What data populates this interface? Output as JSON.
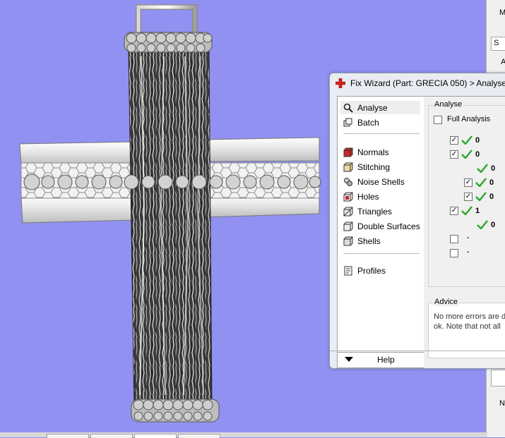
{
  "dialog": {
    "title": "Fix Wizard (Part: GRECIA 050) > Analyse"
  },
  "nav": {
    "items": [
      {
        "label": "Analyse",
        "icon": "magnifier-icon"
      },
      {
        "label": "Batch",
        "icon": "batch-icon"
      },
      {
        "label": "Normals",
        "icon": "normals-cube-icon"
      },
      {
        "label": "Stitching",
        "icon": "stitching-cube-icon"
      },
      {
        "label": "Noise Shells",
        "icon": "noise-shells-icon"
      },
      {
        "label": "Holes",
        "icon": "holes-cube-icon"
      },
      {
        "label": "Triangles",
        "icon": "triangles-cube-icon"
      },
      {
        "label": "Double Surfaces",
        "icon": "double-surfaces-cube-icon"
      },
      {
        "label": "Shells",
        "icon": "shells-cube-icon"
      },
      {
        "label": "Profiles",
        "icon": "profiles-doc-icon"
      }
    ],
    "selected": "Analyse",
    "help_label": "Help"
  },
  "analyse": {
    "group_label": "Analyse",
    "full_analysis_label": "Full Analysis",
    "full_analysis_checked": false,
    "rows": [
      {
        "checkbox": true,
        "checked": true,
        "status": "ok",
        "value": "0"
      },
      {
        "checkbox": true,
        "checked": true,
        "status": "ok",
        "value": "0"
      },
      {
        "checkbox": false,
        "checked": false,
        "status": "ok",
        "value": "0"
      },
      {
        "checkbox": true,
        "checked": true,
        "status": "ok",
        "value": "0"
      },
      {
        "checkbox": true,
        "checked": true,
        "status": "ok",
        "value": "0"
      },
      {
        "checkbox": true,
        "checked": true,
        "status": "ok",
        "value": "1"
      },
      {
        "checkbox": false,
        "checked": false,
        "status": "ok",
        "value": "0"
      },
      {
        "checkbox": true,
        "checked": false,
        "status": "none",
        "value": "."
      },
      {
        "checkbox": true,
        "checked": false,
        "status": "none",
        "value": "."
      }
    ]
  },
  "advice": {
    "group_label": "Advice",
    "line1": "No more errors are d",
    "line2": "ok. Note that not all"
  },
  "right_strip": {
    "text_m": "M",
    "text_s": "S",
    "text_a": "A",
    "text_n": "N"
  },
  "colors": {
    "viewport_bg": "#9191f2",
    "check_green": "#2fa82f",
    "title_cross_red": "#d42020"
  }
}
